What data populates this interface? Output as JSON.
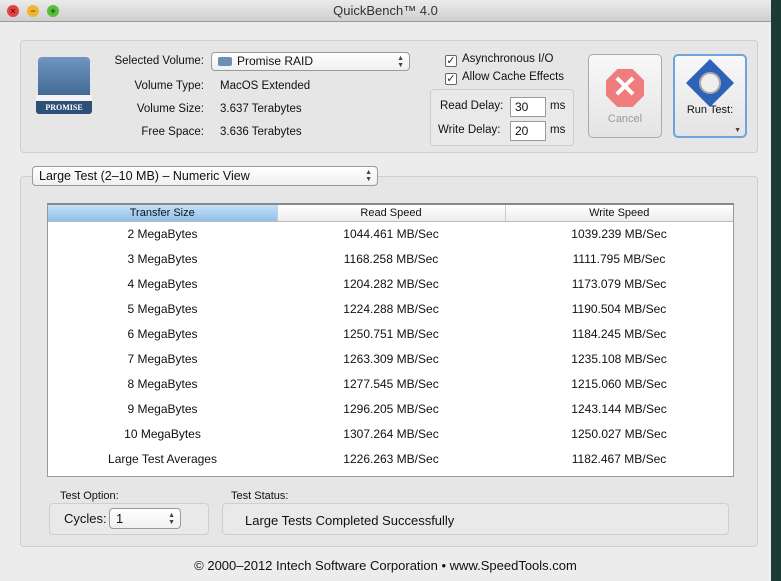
{
  "window": {
    "title": "QuickBench™ 4.0"
  },
  "volume": {
    "icon_label": "PROMISE",
    "selected_label": "Selected Volume:",
    "selected_value": "Promise RAID",
    "type_label": "Volume Type:",
    "type_value": "MacOS Extended",
    "size_label": "Volume Size:",
    "size_value": "3.637 Terabytes",
    "free_label": "Free Space:",
    "free_value": "3.636 Terabytes"
  },
  "options": {
    "async_label": "Asynchronous I/O",
    "async_checked": true,
    "cache_label": "Allow Cache Effects",
    "cache_checked": true,
    "read_delay_label": "Read Delay:",
    "read_delay": "30",
    "write_delay_label": "Write Delay:",
    "write_delay": "20",
    "unit": "ms"
  },
  "buttons": {
    "cancel": "Cancel",
    "run": "Run Test:"
  },
  "view_select": "Large Test (2–10 MB) – Numeric View",
  "table": {
    "headers": [
      "Transfer Size",
      "Read Speed",
      "Write Speed"
    ],
    "rows": [
      [
        "2 MegaBytes",
        "1044.461 MB/Sec",
        "1039.239 MB/Sec"
      ],
      [
        "3 MegaBytes",
        "1168.258 MB/Sec",
        "1111.795 MB/Sec"
      ],
      [
        "4 MegaBytes",
        "1204.282 MB/Sec",
        "1173.079 MB/Sec"
      ],
      [
        "5 MegaBytes",
        "1224.288 MB/Sec",
        "1190.504 MB/Sec"
      ],
      [
        "6 MegaBytes",
        "1250.751 MB/Sec",
        "1184.245 MB/Sec"
      ],
      [
        "7 MegaBytes",
        "1263.309 MB/Sec",
        "1235.108 MB/Sec"
      ],
      [
        "8 MegaBytes",
        "1277.545 MB/Sec",
        "1215.060 MB/Sec"
      ],
      [
        "9 MegaBytes",
        "1296.205 MB/Sec",
        "1243.144 MB/Sec"
      ],
      [
        "10 MegaBytes",
        "1307.264 MB/Sec",
        "1250.027 MB/Sec"
      ],
      [
        "Large Test Averages",
        "1226.263 MB/Sec",
        "1182.467 MB/Sec"
      ]
    ]
  },
  "test_option": {
    "label": "Test Option:",
    "cycles_label": "Cycles:",
    "cycles": "1"
  },
  "status": {
    "label": "Test Status:",
    "text": "Large Tests Completed Successfully"
  },
  "footer": "© 2000–2012 Intech Software Corporation • www.SpeedTools.com"
}
